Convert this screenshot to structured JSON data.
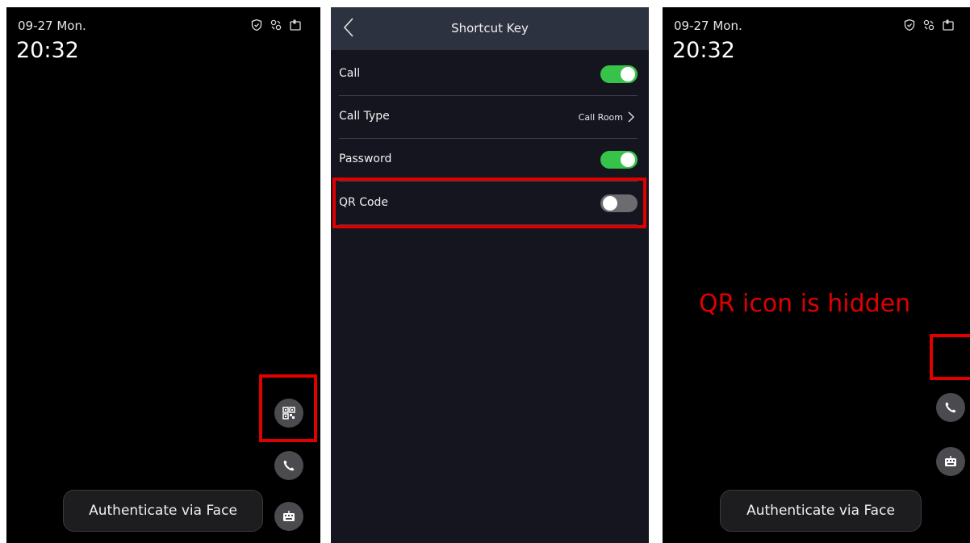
{
  "home_screen": {
    "date": "09-27 Mon.",
    "time": "20:32",
    "status_icons": [
      "shield-icon",
      "link-icon",
      "card-icon"
    ],
    "authenticate_label": "Authenticate via Face",
    "buttons": [
      "qr-code-icon",
      "phone-icon",
      "keyboard-icon"
    ]
  },
  "settings": {
    "title": "Shortcut Key",
    "rows": [
      {
        "label": "Call",
        "type": "toggle",
        "on": true
      },
      {
        "label": "Call Type",
        "type": "link",
        "value": "Call Room"
      },
      {
        "label": "Password",
        "type": "toggle",
        "on": true
      },
      {
        "label": "QR Code",
        "type": "toggle",
        "on": false
      }
    ]
  },
  "result_screen": {
    "date": "09-27 Mon.",
    "time": "20:32",
    "annotation": "QR icon is hidden",
    "authenticate_label": "Authenticate via Face"
  },
  "colors": {
    "highlight": "#e00000",
    "toggle_on": "#37c24a",
    "toggle_off": "#6b6b70",
    "header_bg": "#2d3240"
  }
}
